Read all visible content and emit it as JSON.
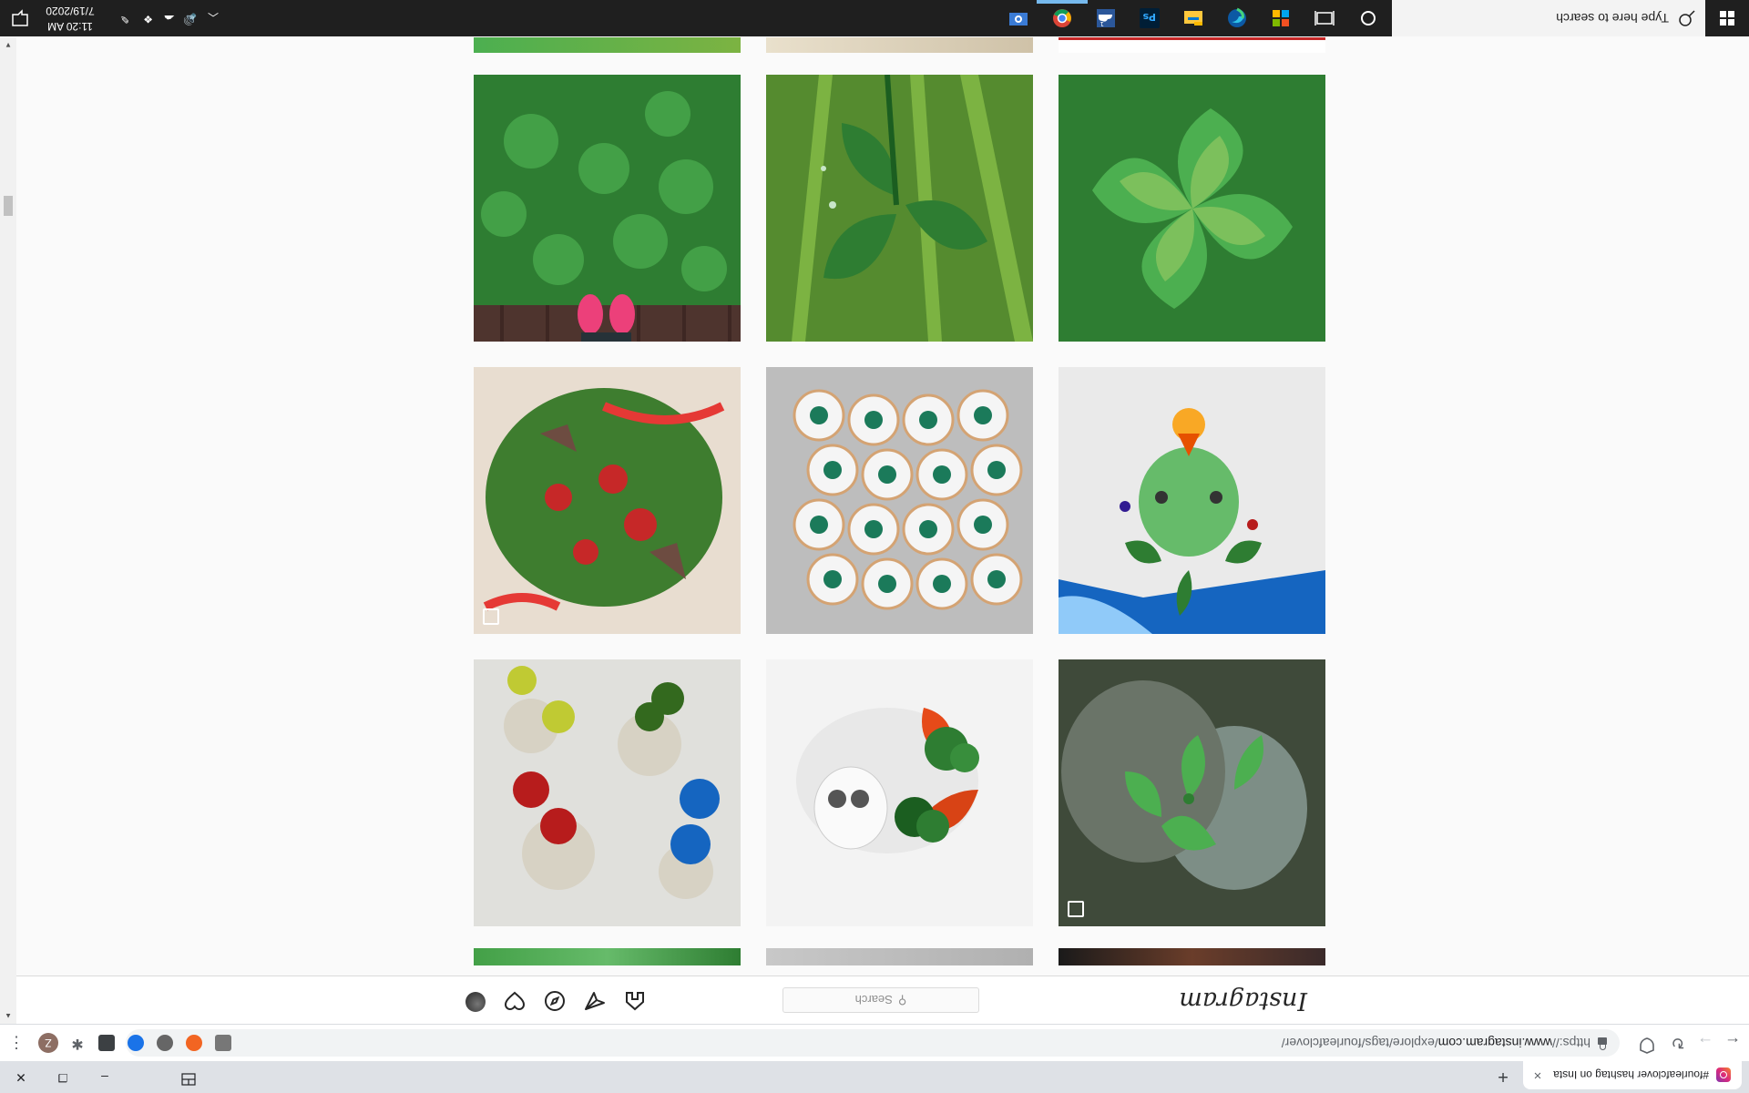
{
  "browser": {
    "tab": {
      "title": "#fourleafclover hashtag on Insta",
      "close": "×"
    },
    "new_tab": "+",
    "window_controls": {
      "minimize": "–",
      "restore": "❐",
      "close": "✕"
    },
    "nav": {
      "back": "←",
      "forward": "→",
      "reload": "↻"
    },
    "url": {
      "scheme": "https://",
      "host": "www.instagram.com",
      "path": "/explore/tags/fourleafclover/"
    },
    "menu_icon": "⋮",
    "profile_initial": "Z"
  },
  "instagram": {
    "logo": "Instagram",
    "search_placeholder": "Search",
    "search_icon": "⚲"
  },
  "grid": {
    "posts": [
      {
        "subject": "pink sneakers on clover patch",
        "multi": false
      },
      {
        "subject": "four leaf clover close-up",
        "multi": false
      },
      {
        "subject": "shamrock leaves with dew",
        "multi": false
      },
      {
        "subject": "red ribbon wreath with ladybug",
        "multi": true
      },
      {
        "subject": "clover painted cookies",
        "multi": false
      },
      {
        "subject": "green glass bird ornament",
        "multi": false
      },
      {
        "subject": "enamel flower earrings on lace",
        "multi": false
      },
      {
        "subject": "ceramic fox and owl with clover",
        "multi": false
      },
      {
        "subject": "clover pressed ceramic dishes",
        "multi": true
      }
    ]
  },
  "taskbar": {
    "search_placeholder": "Type here to search",
    "time": "11:20 AM",
    "date": "7/19/2020",
    "apps": [
      "task-view",
      "edge",
      "store",
      "file-explorer",
      "photoshop",
      "onedrive",
      "chrome",
      "control-panel"
    ]
  },
  "colors": {
    "ig_text": "#262626",
    "chrome_bg": "#dee1e6",
    "taskbar": "#1f1f1f"
  }
}
